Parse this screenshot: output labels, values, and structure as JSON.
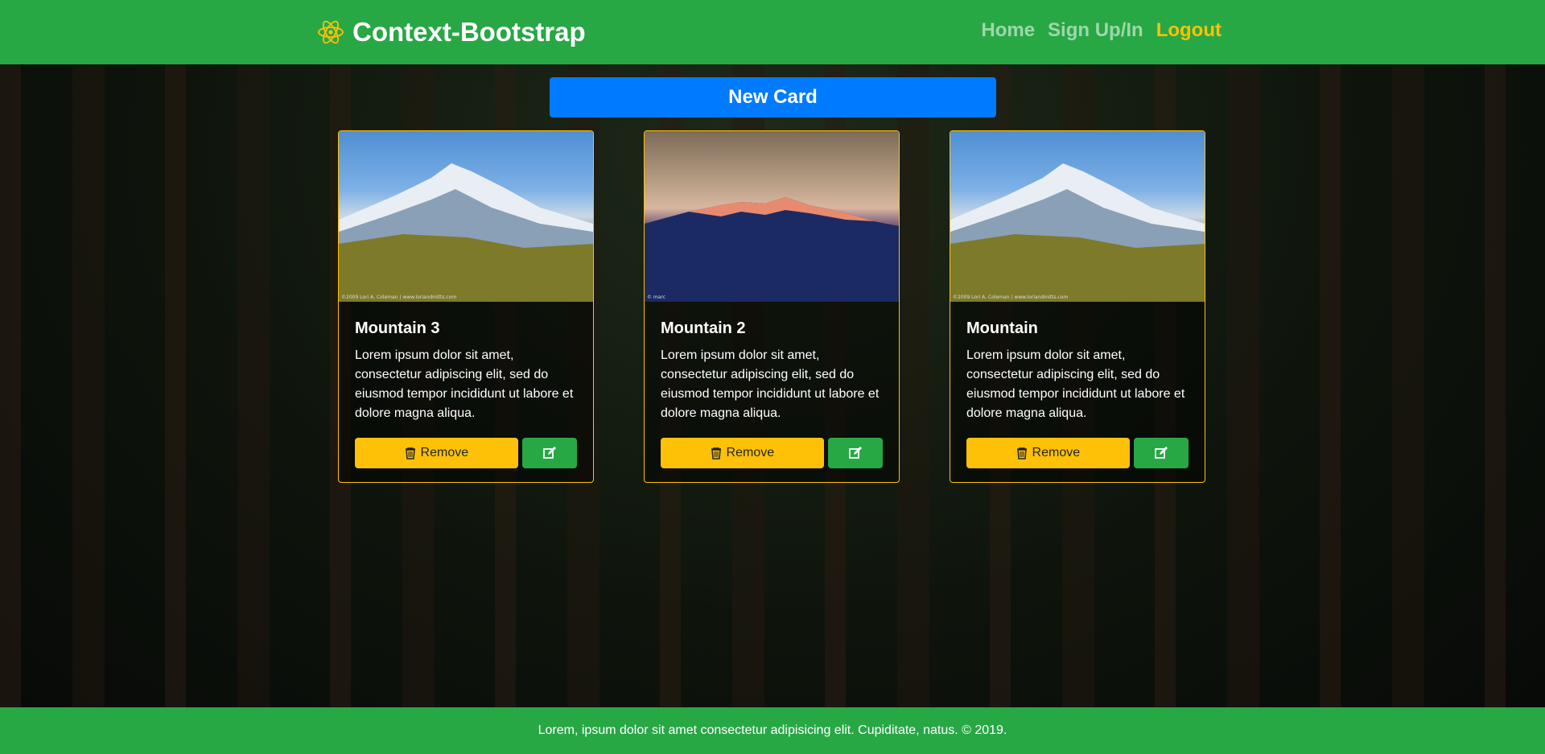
{
  "navbar": {
    "brand": "Context-Bootstrap",
    "brand_icon": "react-atom-icon",
    "links": [
      {
        "label": "Home",
        "state": "muted"
      },
      {
        "label": "Sign Up/In",
        "state": "muted"
      },
      {
        "label": "Logout",
        "state": "active"
      }
    ]
  },
  "actions": {
    "new_card_label": "New Card"
  },
  "cards": [
    {
      "title": "Mountain 3",
      "text": "Lorem ipsum dolor sit amet, consectetur adipiscing elit, sed do eiusmod tempor incididunt ut labore et dolore magna aliqua.",
      "remove_label": "Remove",
      "image_credit": "©2009 Lori A. Coleman | www.loriandmitts.com"
    },
    {
      "title": "Mountain 2",
      "text": "Lorem ipsum dolor sit amet, consectetur adipiscing elit, sed do eiusmod tempor incididunt ut labore et dolore magna aliqua.",
      "remove_label": "Remove",
      "image_credit": "© marc"
    },
    {
      "title": "Mountain",
      "text": "Lorem ipsum dolor sit amet, consectetur adipiscing elit, sed do eiusmod tempor incididunt ut labore et dolore magna aliqua.",
      "remove_label": "Remove",
      "image_credit": "©2009 Lori A. Coleman | www.loriandmitts.com"
    }
  ],
  "footer": {
    "text": "Lorem, ipsum dolor sit amet consectetur adipisicing elit. Cupiditate, natus. © 2019."
  },
  "colors": {
    "primary": "#007bff",
    "success": "#28a745",
    "warning": "#ffc107"
  },
  "icons": {
    "remove": "trash-icon",
    "edit": "edit-icon"
  }
}
